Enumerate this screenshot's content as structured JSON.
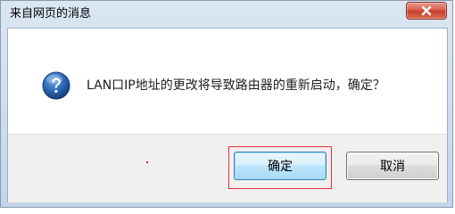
{
  "dialog": {
    "title": "来自网页的消息",
    "close_icon": "close-x-icon",
    "message_icon": "question-icon",
    "message": "LAN口IP地址的更改将导致路由器的重新启动，确定？",
    "buttons": {
      "ok_label": "确定",
      "cancel_label": "取消"
    }
  },
  "colors": {
    "frame": "#c4d5ea",
    "close_button": "#c63e2b",
    "highlight": "#e0303a",
    "icon_blue": "#1f4f8f"
  }
}
